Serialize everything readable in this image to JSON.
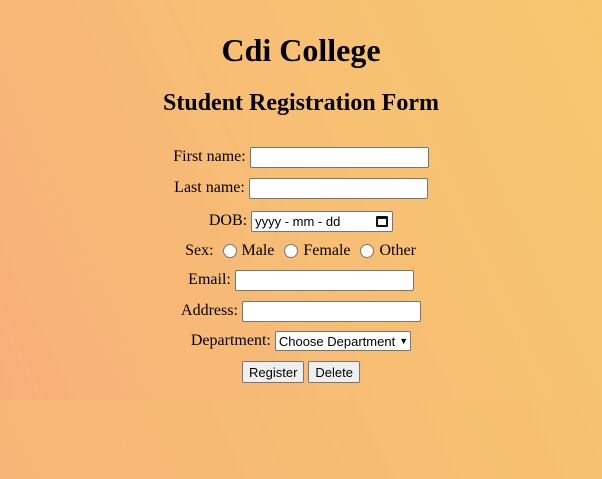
{
  "page": {
    "college_title": "Cdi College",
    "form_title": "Student Registration Form"
  },
  "form": {
    "first_name": {
      "label": "First name:",
      "value": ""
    },
    "last_name": {
      "label": "Last name:",
      "value": ""
    },
    "dob": {
      "label": "DOB:",
      "placeholder": "yyyy - mm - dd"
    },
    "sex": {
      "label": "Sex:",
      "options": [
        "Male",
        "Female",
        "Other"
      ]
    },
    "email": {
      "label": "Email:",
      "value": ""
    },
    "address": {
      "label": "Address:",
      "value": ""
    },
    "department": {
      "label": "Department:",
      "selected": "Choose Department"
    },
    "register_label": "Register",
    "delete_label": "Delete"
  }
}
